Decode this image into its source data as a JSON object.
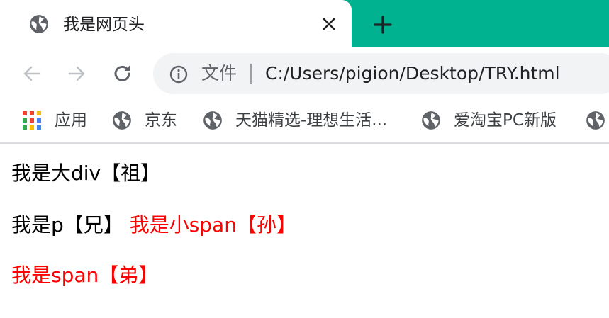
{
  "tab": {
    "title": "我是网页头",
    "icon": "globe-icon"
  },
  "toolbar": {
    "site_label": "文件",
    "url": "C:/Users/pigion/Desktop/TRY.html"
  },
  "bookmarks": [
    {
      "label": "应用",
      "icon": "apps-grid-icon"
    },
    {
      "label": "京东",
      "icon": "globe-icon"
    },
    {
      "label": "天猫精选-理想生活...",
      "icon": "globe-icon"
    },
    {
      "label": "爱淘宝PC新版",
      "icon": "globe-icon"
    }
  ],
  "page": {
    "div_text": "我是大div【祖】",
    "p_text": "我是p【兄】",
    "small_span_text": "我是小span【孙】",
    "span_text": "我是span【弟】"
  },
  "colors": {
    "tabstrip": "#00b28f",
    "red_text": "#ff0000"
  }
}
